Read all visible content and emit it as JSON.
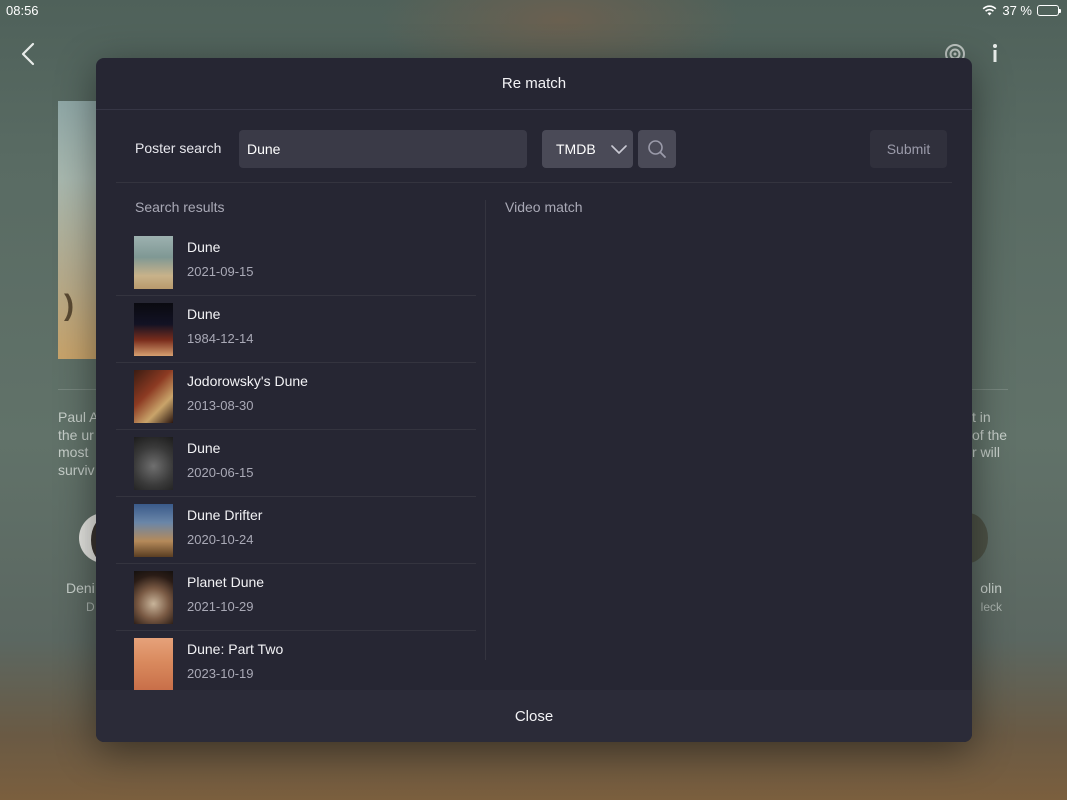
{
  "status_bar": {
    "time": "08:56",
    "battery": "37 %",
    "battery_level": 0.37
  },
  "background": {
    "overview_left": [
      "Paul A",
      "the ur",
      "most ",
      "surviv"
    ],
    "overview_right": [
      "t in",
      "of the",
      "r will"
    ],
    "cast_left": {
      "name": "Deni",
      "role": "D"
    },
    "cast_right": {
      "name": "olin",
      "role": "leck"
    }
  },
  "modal": {
    "title": "Re match",
    "search": {
      "label": "Poster search",
      "query": "Dune",
      "source": "TMDB",
      "submit_label": "Submit"
    },
    "results_title": "Search results",
    "video_match_title": "Video match",
    "results": [
      {
        "title": "Dune",
        "date": "2021-09-15"
      },
      {
        "title": "Dune",
        "date": "1984-12-14"
      },
      {
        "title": "Jodorowsky's Dune",
        "date": "2013-08-30"
      },
      {
        "title": "Dune",
        "date": "2020-06-15"
      },
      {
        "title": "Dune Drifter",
        "date": "2020-10-24"
      },
      {
        "title": "Planet Dune",
        "date": "2021-10-29"
      },
      {
        "title": "Dune: Part Two",
        "date": "2023-10-19"
      }
    ],
    "close_label": "Close"
  },
  "icons": {
    "back": "chevron-left-icon",
    "cast": "cast-icon",
    "info": "info-icon",
    "search": "search-icon",
    "dropdown": "chevron-down-icon",
    "wifi": "wifi-icon",
    "battery": "battery-icon"
  },
  "colors": {
    "modal_bg": "#262633",
    "input_bg": "#3a3a47",
    "select_bg": "#4a4a57",
    "muted_text": "#a9a9b6"
  }
}
